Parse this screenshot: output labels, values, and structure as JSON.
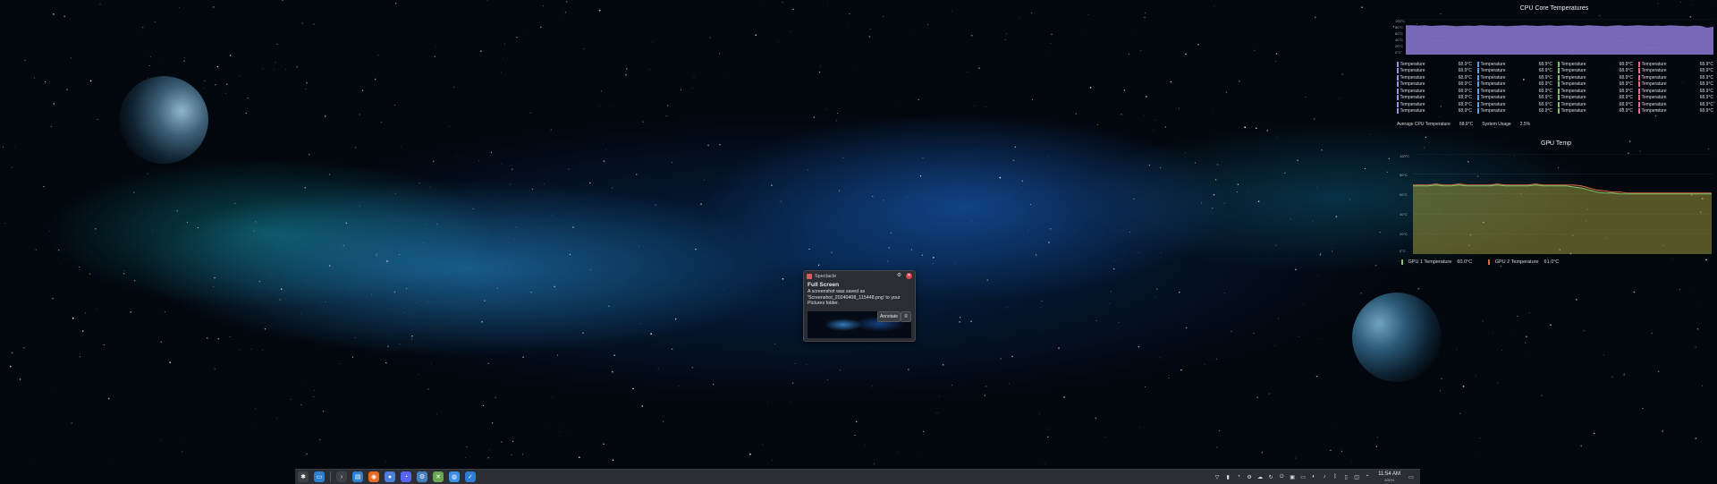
{
  "cpu_widget": {
    "title": "CPU Core Temperatures",
    "axis_ticks": [
      "100°C",
      "80°C",
      "60°C",
      "40°C",
      "20°C",
      "0°C"
    ],
    "graph_color": "#8e7ad6",
    "columns": [
      {
        "color": "#9b8fe0",
        "rows": [
          {
            "label": "Temperature",
            "value": "68.9°C"
          },
          {
            "label": "Temperature",
            "value": "68.9°C"
          },
          {
            "label": "Temperature",
            "value": "68.9°C"
          },
          {
            "label": "Temperature",
            "value": "68.9°C"
          },
          {
            "label": "Temperature",
            "value": "68.9°C"
          },
          {
            "label": "Temperature",
            "value": "68.9°C"
          },
          {
            "label": "Temperature",
            "value": "68.9°C"
          },
          {
            "label": "Temperature",
            "value": "68.9°C"
          }
        ]
      },
      {
        "color": "#5aa0e8",
        "rows": [
          {
            "label": "Temperature",
            "value": "68.9°C"
          },
          {
            "label": "Temperature",
            "value": "68.9°C"
          },
          {
            "label": "Temperature",
            "value": "68.9°C"
          },
          {
            "label": "Temperature",
            "value": "68.9°C"
          },
          {
            "label": "Temperature",
            "value": "68.9°C"
          },
          {
            "label": "Temperature",
            "value": "68.9°C"
          },
          {
            "label": "Temperature",
            "value": "68.9°C"
          },
          {
            "label": "Temperature",
            "value": "68.9°C"
          }
        ]
      },
      {
        "color": "#7cc46a",
        "rows": [
          {
            "label": "Temperature",
            "value": "68.9°C"
          },
          {
            "label": "Temperature",
            "value": "68.9°C"
          },
          {
            "label": "Temperature",
            "value": "68.9°C"
          },
          {
            "label": "Temperature",
            "value": "68.9°C"
          },
          {
            "label": "Temperature",
            "value": "68.9°C"
          },
          {
            "label": "Temperature",
            "value": "68.9°C"
          },
          {
            "label": "Temperature",
            "value": "68.9°C"
          },
          {
            "label": "Temperature",
            "value": "68.9°C"
          }
        ]
      },
      {
        "color": "#e56b8a",
        "rows": [
          {
            "label": "Temperature",
            "value": "68.9°C"
          },
          {
            "label": "Temperature",
            "value": "68.9°C"
          },
          {
            "label": "Temperature",
            "value": "68.9°C"
          },
          {
            "label": "Temperature",
            "value": "68.9°C"
          },
          {
            "label": "Temperature",
            "value": "68.9°C"
          },
          {
            "label": "Temperature",
            "value": "68.9°C"
          },
          {
            "label": "Temperature",
            "value": "68.9°C"
          },
          {
            "label": "Temperature",
            "value": "68.9°C"
          }
        ]
      }
    ],
    "summary": [
      {
        "label": "Average CPU Temperature",
        "value": "68.9°C"
      },
      {
        "label": "System Usage",
        "value": "2.5%"
      }
    ]
  },
  "gpu_widget": {
    "title": "GPU Temp",
    "axis_ticks": [
      "100°C",
      "80°C",
      "60°C",
      "40°C",
      "20°C",
      "0°C"
    ],
    "legend": [
      {
        "label": "GPU 1 Temperature",
        "value": "60.0°C",
        "color": "#7cc46a"
      },
      {
        "label": "GPU 2 Temperature",
        "value": "61.0°C",
        "color": "#d46a3c"
      }
    ]
  },
  "chart_data": [
    {
      "type": "area",
      "title": "CPU Core Temperatures",
      "ylim": [
        0,
        100
      ],
      "series": [
        {
          "values": [
            82,
            82,
            81,
            82,
            80,
            81,
            82,
            81,
            79,
            80,
            81,
            80,
            82,
            81,
            80,
            81,
            79,
            80,
            81,
            82,
            81,
            80,
            81,
            82,
            80,
            81,
            82,
            81,
            80,
            82,
            81,
            80,
            79,
            81,
            82,
            80,
            81,
            82,
            81,
            80,
            81,
            80,
            82,
            81,
            80,
            79,
            81,
            80,
            75,
            78
          ]
        }
      ]
    },
    {
      "type": "area",
      "title": "GPU Temp",
      "ylim": [
        0,
        100
      ],
      "series": [
        {
          "name": "GPU 1 Temperature",
          "values": [
            68,
            68,
            68,
            69,
            68,
            68,
            69,
            68,
            68,
            68,
            68,
            69,
            68,
            68,
            68,
            68,
            69,
            68,
            68,
            68,
            68,
            67,
            66,
            64,
            62,
            61,
            61,
            60,
            60,
            60,
            60,
            60,
            60,
            60,
            60,
            60,
            60,
            60,
            60,
            60
          ]
        },
        {
          "name": "GPU 2 Temperature",
          "values": [
            69,
            69,
            69,
            70,
            69,
            69,
            70,
            69,
            69,
            69,
            69,
            70,
            69,
            69,
            69,
            69,
            70,
            69,
            69,
            69,
            69,
            69,
            68,
            66,
            64,
            63,
            62,
            62,
            61,
            61,
            61,
            61,
            61,
            61,
            61,
            61,
            61,
            61,
            61,
            61
          ]
        }
      ]
    }
  ],
  "notification": {
    "app_name": "Spectacle",
    "title": "Full Screen",
    "body_lines": [
      "A screenshot was saved as",
      "'Screenshot_20240408_115448.png' to your",
      "Pictures folder."
    ],
    "annotate_label": "Annotate",
    "menu_icon": "hamburger-icon",
    "config_icon": "configure-icon",
    "close_icon": "close-icon"
  },
  "taskbar": {
    "left_icons": [
      {
        "name": "application-launcher-icon",
        "color": "#3d4045",
        "glyph": "✱"
      },
      {
        "name": "file-manager-pinned-icon",
        "color": "#2d7fd0",
        "glyph": "▭"
      },
      {
        "name": "terminal-icon",
        "color": "#3d4045",
        "glyph": "›"
      },
      {
        "name": "dolphin-icon",
        "color": "#2d7fd0",
        "glyph": "▤"
      },
      {
        "name": "firefox-icon",
        "color": "#e66a1f",
        "glyph": "◉"
      },
      {
        "name": "chromium-icon",
        "color": "#4a7fdc",
        "glyph": "●"
      },
      {
        "name": "discord-icon",
        "color": "#5865f2",
        "glyph": "◔"
      },
      {
        "name": "steam-icon",
        "color": "#4a7fbf",
        "glyph": "⚙"
      },
      {
        "name": "xbox-icon",
        "color": "#6aa84f",
        "glyph": "✕"
      },
      {
        "name": "messenger-icon",
        "color": "#3e8fe8",
        "glyph": "◍"
      },
      {
        "name": "tasks-icon",
        "color": "#2f7bd6",
        "glyph": "✓"
      }
    ],
    "tray_icons": [
      {
        "name": "vpn-icon",
        "glyph": "▽"
      },
      {
        "name": "kdeconnect-icon",
        "glyph": "▮"
      },
      {
        "name": "discord-tray-icon",
        "glyph": "◔"
      },
      {
        "name": "steam-tray-icon",
        "glyph": "⚙"
      },
      {
        "name": "cloud-icon",
        "glyph": "☁"
      },
      {
        "name": "sync-icon",
        "glyph": "↻"
      },
      {
        "name": "power-icon",
        "glyph": "⏻"
      },
      {
        "name": "clipboard-icon",
        "glyph": "▣"
      },
      {
        "name": "display-icon",
        "glyph": "▭"
      },
      {
        "name": "disk-icon",
        "glyph": "◐"
      },
      {
        "name": "volume-icon",
        "glyph": "♪"
      },
      {
        "name": "bluetooth-icon",
        "glyph": "ᛒ"
      },
      {
        "name": "battery-icon",
        "glyph": "▯"
      },
      {
        "name": "network-icon",
        "glyph": "◫"
      },
      {
        "name": "expand-tray-icon",
        "glyph": "⌃"
      }
    ],
    "clock": {
      "time": "11:54 AM",
      "date": "4/8/24"
    },
    "show_desktop_icon": "show-desktop-icon"
  }
}
